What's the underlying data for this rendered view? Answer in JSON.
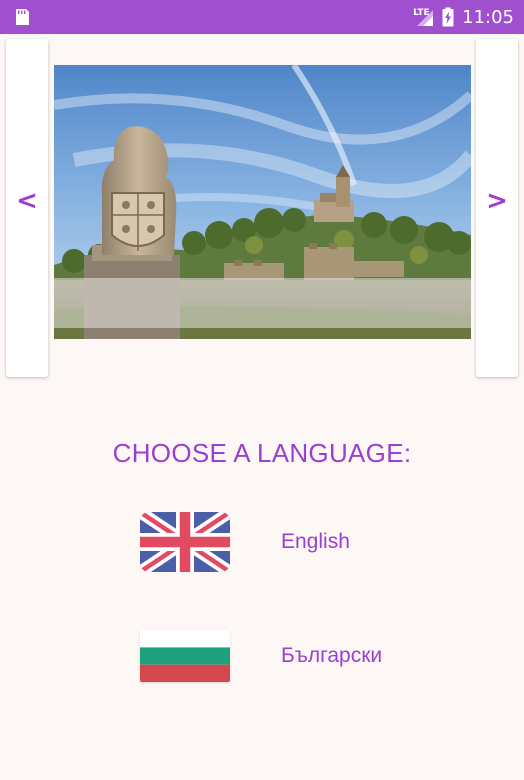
{
  "status_bar": {
    "network": "LTE",
    "time": "11:05",
    "color": "#a04fcf",
    "icons": [
      "sd-card-icon",
      "signal-icon",
      "battery-charging-icon"
    ]
  },
  "carousel": {
    "prev_label": "<",
    "next_label": ">",
    "image": "veliko-tarnovo-castle-photo"
  },
  "title": "CHOOSE A LANGUAGE:",
  "languages": [
    {
      "label": "English",
      "flag": "uk-flag-icon"
    },
    {
      "label": "Български",
      "flag": "bulgaria-flag-icon"
    }
  ],
  "accent_color": "#9a3fcf",
  "background_color": "#fdf8f6"
}
